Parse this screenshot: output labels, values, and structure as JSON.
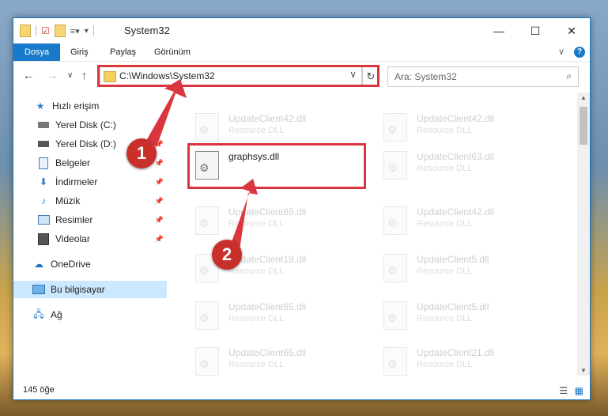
{
  "window": {
    "title": "System32",
    "minimize_glyph": "—",
    "maximize_glyph": "☐",
    "close_glyph": "✕"
  },
  "ribbon": {
    "tabs": [
      {
        "label": "Dosya",
        "active": true
      },
      {
        "label": "Giriş",
        "active": false
      },
      {
        "label": "Paylaş",
        "active": false
      },
      {
        "label": "Görünüm",
        "active": false
      }
    ],
    "expand_glyph": "∨",
    "help_glyph": "?"
  },
  "navigation": {
    "back_glyph": "←",
    "forward_glyph": "→",
    "recent_glyph": "∨",
    "up_glyph": "↑",
    "address_path": "C:\\Windows\\System32",
    "address_dropdown_glyph": "∨",
    "refresh_glyph": "↻",
    "search_placeholder": "Ara: System32"
  },
  "sidebar": {
    "items": [
      {
        "label": "Hızlı erişim",
        "icon": "star-icon",
        "pinned": false
      },
      {
        "label": "Yerel Disk (C:)",
        "icon": "drive-icon",
        "pinned": false
      },
      {
        "label": "Yerel Disk (D:)",
        "icon": "drive-icon",
        "pinned": true
      },
      {
        "label": "Belgeler",
        "icon": "documents-icon",
        "pinned": true
      },
      {
        "label": "İndirmeler",
        "icon": "downloads-icon",
        "pinned": true
      },
      {
        "label": "Müzik",
        "icon": "music-icon",
        "pinned": true
      },
      {
        "label": "Resimler",
        "icon": "pictures-icon",
        "pinned": true
      },
      {
        "label": "Videolar",
        "icon": "videos-icon",
        "pinned": true
      },
      {
        "label": "OneDrive",
        "icon": "cloud-icon",
        "pinned": false
      },
      {
        "label": "Bu bilgisayar",
        "icon": "computer-icon",
        "pinned": false,
        "selected": true
      },
      {
        "label": "Ağ",
        "icon": "network-icon",
        "pinned": false
      }
    ]
  },
  "files": [
    {
      "name": "UpdateClient42.dll",
      "type": "Resource DLL"
    },
    {
      "name": "UpdateClient42.dll",
      "type": "Resource DLL"
    },
    {
      "name": "graphsys.dll",
      "type": ""
    },
    {
      "name": "UpdateClient63.dll",
      "type": "Resource DLL"
    },
    {
      "name": "UpdateClient65.dll",
      "type": "Resource DLL"
    },
    {
      "name": "UpdateClient42.dll",
      "type": "Resource DLL"
    },
    {
      "name": "UpdateClient19.dll",
      "type": "Resource DLL"
    },
    {
      "name": "UpdateClient5.dll",
      "type": "Resource DLL"
    },
    {
      "name": "UpdateClient65.dll",
      "type": "Resource DLL"
    },
    {
      "name": "UpdateClient5.dll",
      "type": "Resource DLL"
    },
    {
      "name": "UpdateClient65.dll",
      "type": "Resource DLL"
    },
    {
      "name": "UpdateClient21.dll",
      "type": "Resource DLL"
    }
  ],
  "status": {
    "item_count": "145 öğe"
  },
  "callouts": {
    "step1": "1",
    "step2": "2"
  },
  "colors": {
    "accent": "#1979ca",
    "highlight": "#d9363e",
    "badge": "#c9302c"
  }
}
